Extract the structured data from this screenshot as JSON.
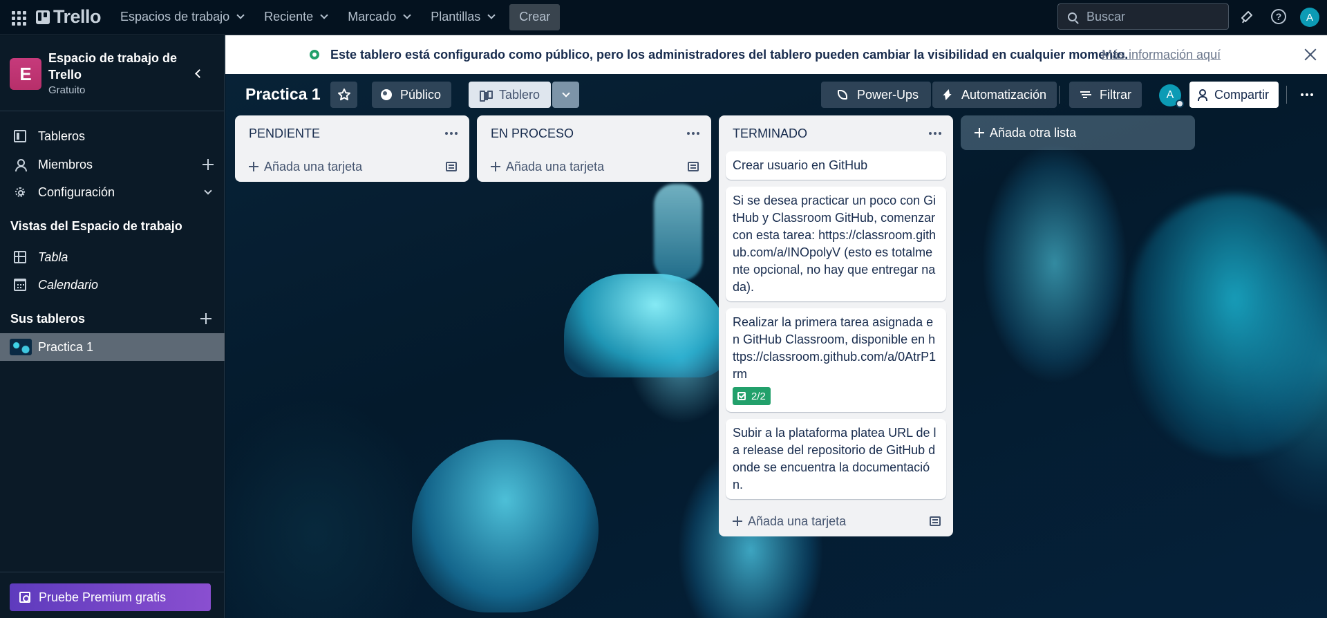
{
  "topbar": {
    "logo": "Trello",
    "menu": [
      {
        "label": "Espacios de trabajo"
      },
      {
        "label": "Reciente"
      },
      {
        "label": "Marcado"
      },
      {
        "label": "Plantillas"
      }
    ],
    "create_label": "Crear",
    "search_placeholder": "Buscar",
    "avatar_initial": "A"
  },
  "sidebar": {
    "workspace_initial": "E",
    "workspace_name": "Espacio de trabajo de Trello",
    "workspace_plan": "Gratuito",
    "items": [
      {
        "label": "Tableros"
      },
      {
        "label": "Miembros"
      },
      {
        "label": "Configuración"
      }
    ],
    "views_title": "Vistas del Espacio de trabajo",
    "views": [
      {
        "label": "Tabla"
      },
      {
        "label": "Calendario"
      }
    ],
    "boards_title": "Sus tableros",
    "boards": [
      {
        "label": "Practica 1"
      }
    ],
    "premium_label": "Pruebe Premium gratis"
  },
  "banner": {
    "text": "Este tablero está configurado como público, pero los administradores del tablero pueden cambiar la visibilidad en cualquier momento.",
    "link": "Más información aquí"
  },
  "board": {
    "title": "Practica 1",
    "visibility_label": "Público",
    "view_label": "Tablero",
    "powerups_label": "Power-Ups",
    "automation_label": "Automatización",
    "filter_label": "Filtrar",
    "member_initial": "A",
    "share_label": "Compartir",
    "add_list_label": "Añada otra lista"
  },
  "lists": [
    {
      "title": "PENDIENTE",
      "add_card_label": "Añada una tarjeta",
      "cards": []
    },
    {
      "title": "EN PROCESO",
      "add_card_label": "Añada una tarjeta",
      "cards": []
    },
    {
      "title": "TERMINADO",
      "add_card_label": "Añada una tarjeta",
      "cards": [
        {
          "text": "Crear usuario en GitHub"
        },
        {
          "text": "Si se desea practicar un poco con GitHub y Classroom GitHub, comenzar con esta tarea: https://classroom.github.com/a/INOpolyV (esto es totalmente opcional, no hay que entregar nada)."
        },
        {
          "text": "Realizar la primera tarea asignada en GitHub Classroom, disponible en https://classroom.github.com/a/0AtrP1rm",
          "checklist": "2/2"
        },
        {
          "text": "Subir a la plataforma platea URL de la release del repositorio de GitHub donde se encuentra la documentación."
        }
      ]
    }
  ],
  "colors": {
    "topbar_bg": "#04121f",
    "sidebar_bg": "#0b1a27",
    "workspace_badge": "#c63a7b",
    "checklist_complete": "#22a06b",
    "premium_gradient": [
      "#5e3bbd",
      "#8a4fd0"
    ]
  }
}
